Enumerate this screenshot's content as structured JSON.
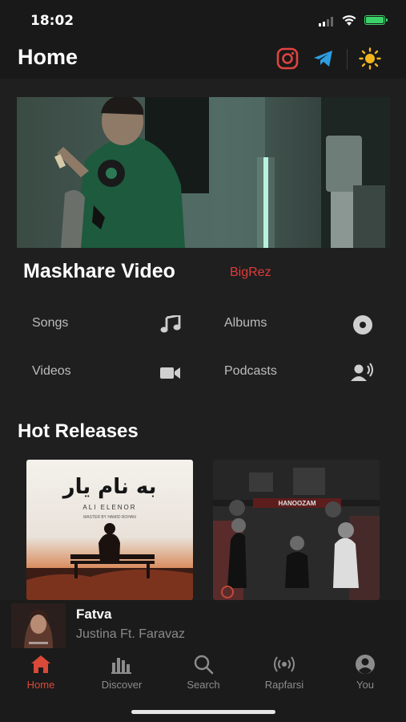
{
  "status_bar": {
    "time": "18:02"
  },
  "header": {
    "title": "Home",
    "icons": [
      "instagram-icon",
      "telegram-icon",
      "sun-icon"
    ]
  },
  "featured": {
    "title": "Maskhare Video",
    "artist": "BigRez"
  },
  "categories": [
    {
      "label": "Songs",
      "icon": "music-note-icon"
    },
    {
      "label": "Albums",
      "icon": "disc-icon"
    },
    {
      "label": "Videos",
      "icon": "video-camera-icon"
    },
    {
      "label": "Podcasts",
      "icon": "podcast-speaker-icon"
    }
  ],
  "hot_releases": {
    "title": "Hot Releases",
    "items": [
      {
        "cover_title_fa": "به نام یار",
        "cover_subtitle": "ALI ELENOR",
        "cover_credit": "MASTER BY HAMID ROHAN"
      },
      {
        "cover_title": "HANOOZAM"
      }
    ]
  },
  "now_playing": {
    "song": "Fatva",
    "artist": "Justina Ft. Faravaz"
  },
  "tabs": [
    {
      "label": "Home",
      "icon": "home-icon",
      "active": true
    },
    {
      "label": "Discover",
      "icon": "bar-chart-icon",
      "active": false
    },
    {
      "label": "Search",
      "icon": "search-icon",
      "active": false
    },
    {
      "label": "Rapfarsi",
      "icon": "radio-icon",
      "active": false
    },
    {
      "label": "You",
      "icon": "user-icon",
      "active": false
    }
  ],
  "colors": {
    "accent": "#d94a38",
    "artist_red": "#e03b3b",
    "background": "#1f1f1f",
    "instagram": "#e0443e",
    "telegram": "#2d9ee0",
    "sun": "#f2b51c"
  }
}
